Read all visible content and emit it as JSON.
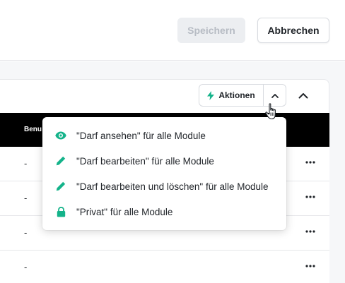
{
  "toolbar": {
    "save_label": "Speichern",
    "cancel_label": "Abbrechen"
  },
  "actions": {
    "label": "Aktionen"
  },
  "table": {
    "header_label": "Benu",
    "rows": [
      {
        "value": "-"
      },
      {
        "value": "-"
      },
      {
        "value": "-"
      },
      {
        "value": "-"
      }
    ]
  },
  "dropdown": {
    "items": [
      {
        "label": "\"Darf ansehen\" für alle Module",
        "icon": "eye-icon"
      },
      {
        "label": "\"Darf bearbeiten\" für alle Module",
        "icon": "pencil-icon"
      },
      {
        "label": "\"Darf bearbeiten und löschen\" für alle Module",
        "icon": "pencil-icon"
      },
      {
        "label": "\"Privat\" für alle Module",
        "icon": "lock-icon"
      }
    ]
  },
  "colors": {
    "accent": "#14b38a",
    "header_bg": "#000000",
    "disabled_bg": "#eceef1"
  }
}
